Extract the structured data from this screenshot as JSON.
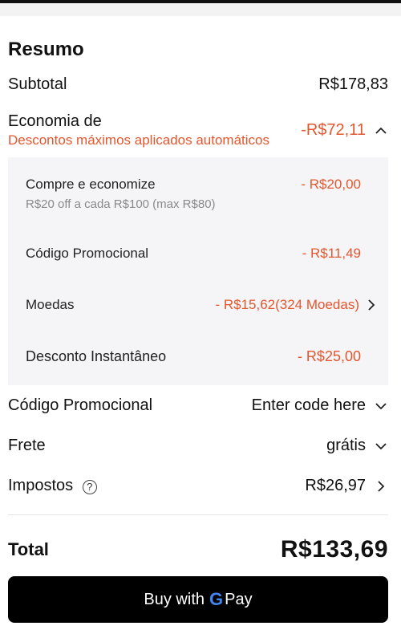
{
  "summary": {
    "title": "Resumo",
    "subtotal_label": "Subtotal",
    "subtotal_value": "R$178,83",
    "savings_label": "Economia de",
    "savings_sub": "Descontos máximos aplicados automáticos",
    "savings_value": "-R$72,11"
  },
  "discounts": [
    {
      "label": "Compre e economize",
      "value": "- R$20,00",
      "sub": "R$20 off a cada R$100 (max R$80)"
    },
    {
      "label": "Código Promocional",
      "value": "- R$11,49"
    },
    {
      "label": "Moedas",
      "value": "- R$15,62(324 Moedas)"
    },
    {
      "label": "Desconto Instantâneo",
      "value": "- R$25,00"
    }
  ],
  "promo": {
    "label": "Código Promocional",
    "value": "Enter code here"
  },
  "shipping": {
    "label": "Frete",
    "value": "grátis"
  },
  "taxes": {
    "label": "Impostos",
    "help": "?",
    "value": "R$26,97"
  },
  "total": {
    "label": "Total",
    "value": "R$133,69"
  },
  "pay_button": {
    "prefix": "Buy with",
    "g": "G",
    "suffix": "Pay"
  },
  "colors": {
    "accent": "#e4572e",
    "panel_bg": "#f5f5f7",
    "button_bg": "#000000"
  }
}
